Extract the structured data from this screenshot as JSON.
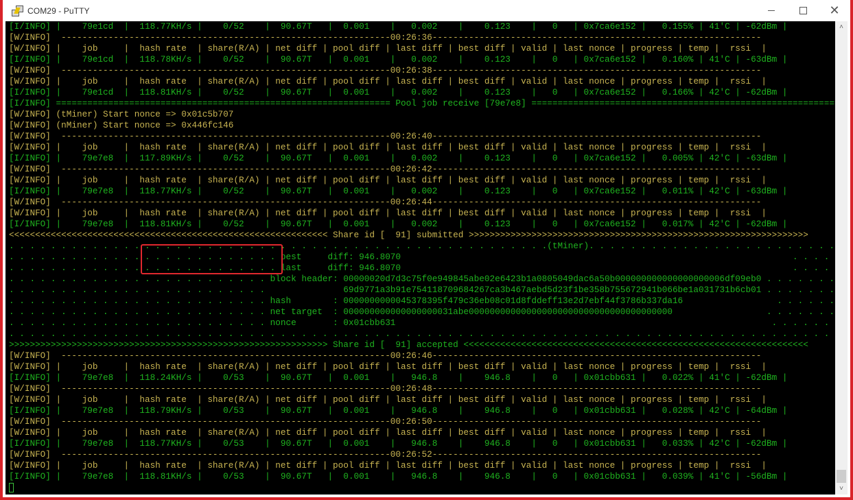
{
  "window": {
    "title": "COM29 - PuTTY",
    "controls": {
      "minimize": "minimize",
      "maximize": "maximize",
      "close": "close"
    }
  },
  "terminal": {
    "colors": {
      "info_green": "#1fb31f",
      "warn_yellow": "#c8b452",
      "background": "#000000",
      "highlight_box": "#e0282e"
    },
    "lines": [
      {
        "c": "g",
        "t": "[I/INFO] |    79e1cd  |  118.77KH/s |    0/52    |  90.67T   |  0.001    |   0.002    |    0.123    |   0   | 0x7ca6e152 |   0.155% | 41'C | -62dBm |"
      },
      {
        "c": "y",
        "t": "[W/INFO]  ---------------------------------------------------------------00:26:36---------------------------------------------------------------"
      },
      {
        "c": "y",
        "t": "[W/INFO] |    job     |  hash rate  | share(R/A) | net diff | pool diff | last diff | best diff | valid | last nonce | progress | temp |  rssi  |"
      },
      {
        "c": "g",
        "t": "[I/INFO] |    79e1cd  |  118.78KH/s |    0/52    |  90.67T   |  0.001    |   0.002    |    0.123    |   0   | 0x7ca6e152 |   0.160% | 41'C | -63dBm |"
      },
      {
        "c": "y",
        "t": "[W/INFO]  ---------------------------------------------------------------00:26:38---------------------------------------------------------------"
      },
      {
        "c": "y",
        "t": "[W/INFO] |    job     |  hash rate  | share(R/A) | net diff | pool diff | last diff | best diff | valid | last nonce | progress | temp |  rssi  |"
      },
      {
        "c": "g",
        "t": "[I/INFO] |    79e1cd  |  118.81KH/s |    0/52    |  90.67T   |  0.001    |   0.002    |    0.123    |   0   | 0x7ca6e152 |   0.166% | 42'C | -62dBm |"
      },
      {
        "c": "g",
        "t": "[I/INFO] ================================================================ Pool job receive [79e7e8] ============================================================"
      },
      {
        "c": "y",
        "t": "[W/INFO] (tMiner) Start nonce => 0x01c5b707"
      },
      {
        "c": "y",
        "t": "[W/INFO] (nMiner) Start nonce => 0x446fc146"
      },
      {
        "c": "y",
        "t": "[W/INFO]  ---------------------------------------------------------------00:26:40---------------------------------------------------------------"
      },
      {
        "c": "y",
        "t": "[W/INFO] |    job     |  hash rate  | share(R/A) | net diff | pool diff | last diff | best diff | valid | last nonce | progress | temp |  rssi  |"
      },
      {
        "c": "g",
        "t": "[I/INFO] |    79e7e8  |  117.89KH/s |    0/52    |  90.67T   |  0.001    |   0.002    |    0.123    |   0   | 0x7ca6e152 |   0.005% | 42'C | -63dBm |"
      },
      {
        "c": "y",
        "t": "[W/INFO]  ---------------------------------------------------------------00:26:42---------------------------------------------------------------"
      },
      {
        "c": "y",
        "t": "[W/INFO] |    job     |  hash rate  | share(R/A) | net diff | pool diff | last diff | best diff | valid | last nonce | progress | temp |  rssi  |"
      },
      {
        "c": "g",
        "t": "[I/INFO] |    79e7e8  |  118.77KH/s |    0/52    |  90.67T   |  0.001    |   0.002    |    0.123    |   0   | 0x7ca6e152 |   0.011% | 42'C | -63dBm |"
      },
      {
        "c": "y",
        "t": "[W/INFO]  ---------------------------------------------------------------00:26:44---------------------------------------------------------------"
      },
      {
        "c": "y",
        "t": "[W/INFO] |    job     |  hash rate  | share(R/A) | net diff | pool diff | last diff | best diff | valid | last nonce | progress | temp |  rssi  |"
      },
      {
        "c": "g",
        "t": "[I/INFO] |    79e7e8  |  118.81KH/s |    0/52    |  90.67T   |  0.001    |   0.002    |    0.123    |   0   | 0x7ca6e152 |   0.017% | 42'C | -62dBm |"
      },
      {
        "c": "y",
        "t": "<<<<<<<<<<<<<<<<<<<<<<<<<<<<<<<<<<<<<<<<<<<<<<<<<<<<<<<<<<<<< Share id [  91] submitted >>>>>>>>>>>>>>>>>>>>>>>>>>>>>>>>>>>>>>>>>>>>>>>>>>>>>>>>>>>>>>>>>"
      },
      {
        "c": "g",
        "t": ". . . . . . . . . . . . . . . . . . . . . . . . . . . . . . . . . . . . . . . . . . . . . . . . . . . .(tMiner). . . . . . . . . . . . . . . . . . . . . . . . . . . . . . . . . . . . . . . . . . . . . . . . . . . . . . . . . ."
      },
      {
        "c": "g",
        "t": ". . . . . . . . . . . . . . . . . . . . . . . . . . best     diff: 946.8070                                                                           . . . . . . . . . . . . . . . . . . . . . ."
      },
      {
        "c": "g",
        "t": ". . . . . . . . . . . . . . . . . . . . . . . . . . last     diff: 946.8070                                                                           . . . . . . . . . . . . . . . . . . . . . ."
      },
      {
        "c": "g",
        "t": ". . . . . . . . . . . . . . . . . . . . . . . . . block header: 00000020d7d3c75f0e949845abe02e6423b1a0805049dac6a50b000000000000000000006df09eb0 . . . . . . . . . . . . . . . . . . . . . ."
      },
      {
        "c": "g",
        "t": ". . . . . . . . . . . . . . . . . . . . . . . . .               69d9771a3b91e754118709684267ca3b467aebd5d23f1be358b755672941b066be1a031731b6cb01 . . . . . . . . . . . . . . . . . . . . . ."
      },
      {
        "c": "g",
        "t": ". . . . . . . . . . . . . . . . . . . . . . . . . hash        : 0000000000045378395f479c36eb08c01d8fddeff13e2d7ebf44f3786b337da16                  . . . . . . . . . . . . . . . . . . . . . ."
      },
      {
        "c": "g",
        "t": ". . . . . . . . . . . . . . . . . . . . . . . . . net target  : 000000000000000000031abe000000000000000000000000000000000000000                  . . . . . . . . . . . . . . . . . . . . . ."
      },
      {
        "c": "g",
        "t": ". . . . . . . . . . . . . . . . . . . . . . . . . nonce       : 0x01cbb631                                                                        . . . . . . . . . . . . . . . . . . . . . ."
      },
      {
        "c": "g",
        "t": ". . . . . . . . . . . . . . . . . . . . . . . . . . . . . . . . . . . . . . . . . . . . . . . . . . . . . . . . . . . . . . . . . . . . . . . . . . . . . . . . . . . . . . . . . . . . . . . . . . . . . . . . . . . . . . ."
      },
      {
        "c": "g",
        "t": ">>>>>>>>>>>>>>>>>>>>>>>>>>>>>>>>>>>>>>>>>>>>>>>>>>>>>>>>>>>>> Share id [  91] accepted <<<<<<<<<<<<<<<<<<<<<<<<<<<<<<<<<<<<<<<<<<<<<<<<<<<<<<<<<<<<<<<<<<"
      },
      {
        "c": "y",
        "t": "[W/INFO]  ---------------------------------------------------------------00:26:46---------------------------------------------------------------"
      },
      {
        "c": "y",
        "t": "[W/INFO] |    job     |  hash rate  | share(R/A) | net diff | pool diff | last diff | best diff | valid | last nonce | progress | temp |  rssi  |"
      },
      {
        "c": "g",
        "t": "[I/INFO] |    79e7e8  |  118.24KH/s |    0/53    |  90.67T   |  0.001    |   946.8    |    946.8    |   0   | 0x01cbb631 |   0.022% | 41'C | -62dBm |"
      },
      {
        "c": "y",
        "t": "[W/INFO]  ---------------------------------------------------------------00:26:48---------------------------------------------------------------"
      },
      {
        "c": "y",
        "t": "[W/INFO] |    job     |  hash rate  | share(R/A) | net diff | pool diff | last diff | best diff | valid | last nonce | progress | temp |  rssi  |"
      },
      {
        "c": "g",
        "t": "[I/INFO] |    79e7e8  |  118.79KH/s |    0/53    |  90.67T   |  0.001    |   946.8    |    946.8    |   0   | 0x01cbb631 |   0.028% | 42'C | -64dBm |"
      },
      {
        "c": "y",
        "t": "[W/INFO]  ---------------------------------------------------------------00:26:50---------------------------------------------------------------"
      },
      {
        "c": "y",
        "t": "[W/INFO] |    job     |  hash rate  | share(R/A) | net diff | pool diff | last diff | best diff | valid | last nonce | progress | temp |  rssi  |"
      },
      {
        "c": "g",
        "t": "[I/INFO] |    79e7e8  |  118.77KH/s |    0/53    |  90.67T   |  0.001    |   946.8    |    946.8    |   0   | 0x01cbb631 |   0.033% | 42'C | -62dBm |"
      },
      {
        "c": "y",
        "t": "[W/INFO]  ---------------------------------------------------------------00:26:52---------------------------------------------------------------"
      },
      {
        "c": "y",
        "t": "[W/INFO] |    job     |  hash rate  | share(R/A) | net diff | pool diff | last diff | best diff | valid | last nonce | progress | temp |  rssi  |"
      },
      {
        "c": "g",
        "t": "[I/INFO] |    79e7e8  |  118.81KH/s |    0/53    |  90.67T   |  0.001    |   946.8    |    946.8    |   0   | 0x01cbb631 |   0.039% | 41'C | -56dBm |"
      }
    ]
  },
  "scrollbar": {
    "up_icon": "^",
    "down_icon": "v"
  }
}
